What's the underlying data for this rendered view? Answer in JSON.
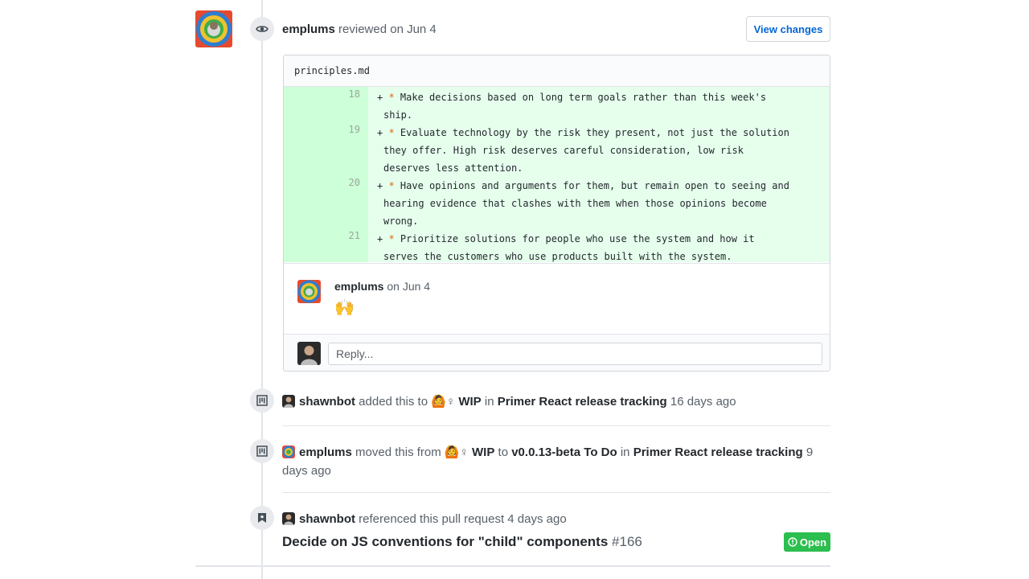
{
  "review": {
    "author": "emplums",
    "action_text": "reviewed on Jun 4",
    "view_changes_label": "View changes",
    "file_name": "principles.md",
    "diff_lines": [
      {
        "line_no": "18",
        "prefix": "+ ",
        "bullet": "*",
        "text_first": " Make decisions based on long term goals rather than this week's",
        "text_cont": [
          "ship."
        ]
      },
      {
        "line_no": "19",
        "prefix": "+ ",
        "bullet": "*",
        "text_first": " Evaluate technology by the risk they present, not just the solution",
        "text_cont": [
          "they offer. High risk deserves careful consideration, low risk",
          "deserves less attention."
        ]
      },
      {
        "line_no": "20",
        "prefix": "+ ",
        "bullet": "*",
        "text_first": " Have opinions and arguments for them, but remain open to seeing and",
        "text_cont": [
          "hearing evidence that clashes with them when those opinions become",
          "wrong."
        ]
      },
      {
        "line_no": "21",
        "prefix": "+ ",
        "bullet": "*",
        "text_first": " Prioritize solutions for people who use the system and how it",
        "text_cont": [
          "serves the customers who use products built with the system."
        ]
      }
    ],
    "comment": {
      "author": "emplums",
      "date_text": "on Jun 4",
      "emoji": "🙌"
    },
    "reply_placeholder": "Reply..."
  },
  "events": [
    {
      "actor": "shawnbot",
      "text1": "added this to",
      "emoji": "🙆",
      "sym": "♀",
      "column": "WIP",
      "text2": "in",
      "project": "Primer React release tracking",
      "time": "16 days ago"
    },
    {
      "actor": "emplums",
      "text1": "moved this from",
      "emoji": "🙆",
      "sym": "♀",
      "from_column": "WIP",
      "text2": "to",
      "to_column": "v0.0.13-beta To Do",
      "text3": "in",
      "project": "Primer React release tracking",
      "time": "9 days ago"
    },
    {
      "actor": "shawnbot",
      "text1": "referenced this pull request",
      "time": "4 days ago",
      "ref_title": "Decide on JS conventions for \"child\" components",
      "ref_number": "#166",
      "status": "Open"
    }
  ],
  "colors": {
    "link": "#0366d6",
    "added_bg": "#e6ffed",
    "added_gutter": "#cdffd8",
    "open_green": "#2cbe4e",
    "bullet": "#e36209"
  }
}
